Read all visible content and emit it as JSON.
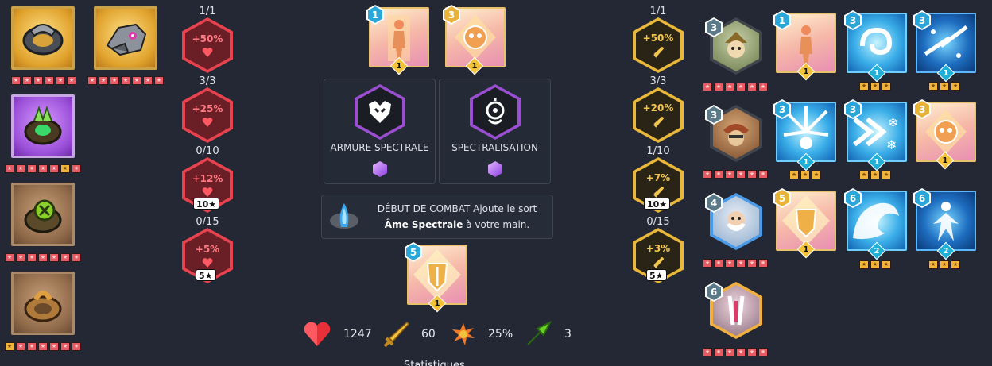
{
  "equipment": [
    {
      "name": "anneau-gris",
      "stars": "6"
    },
    {
      "name": "familier-gris",
      "stars": "7"
    },
    {
      "name": "anneau-violet",
      "stars": "7"
    },
    {
      "name": "anneau-vert",
      "stars": "7"
    },
    {
      "name": "anneau-bronze",
      "stars": "7"
    }
  ],
  "stats_left": [
    {
      "fraction": "1/1",
      "value": "+50%",
      "req": ""
    },
    {
      "fraction": "3/3",
      "value": "+25%",
      "req": ""
    },
    {
      "fraction": "0/10",
      "value": "+12%",
      "req": "10★"
    },
    {
      "fraction": "0/15",
      "value": "+5%",
      "req": "5★"
    }
  ],
  "stats_right": [
    {
      "fraction": "1/1",
      "value": "+50%",
      "req": ""
    },
    {
      "fraction": "3/3",
      "value": "+20%",
      "req": ""
    },
    {
      "fraction": "1/10",
      "value": "+7%",
      "req": "10★"
    },
    {
      "fraction": "0/15",
      "value": "+3%",
      "req": "5★"
    }
  ],
  "center": {
    "top_cards": [
      {
        "cost": "1",
        "level": "1"
      },
      {
        "cost": "3",
        "level": "1"
      }
    ],
    "passives": [
      {
        "name": "ARMURE SPECTRALE"
      },
      {
        "name": "SPECTRALISATION"
      }
    ],
    "effect": {
      "part1": "DÉBUT DE COMBAT Ajoute le sort",
      "bold": "Âme Spectrale",
      "part2": " à votre main."
    },
    "bottom_card": {
      "cost": "5",
      "level": "1"
    }
  },
  "totals": {
    "health": "1247",
    "attack": "60",
    "crit": "25%",
    "move": "3"
  },
  "footer_partial": "Statistiques",
  "companions": [
    {
      "cost": "3"
    },
    {
      "cost": "3"
    },
    {
      "cost": "4"
    },
    {
      "cost": "6"
    }
  ],
  "spells": [
    {
      "cost": "1",
      "level": "1",
      "stars": "",
      "style": "pink"
    },
    {
      "cost": "3",
      "level": "1",
      "stars": "★★★",
      "style": "blue"
    },
    {
      "cost": "3",
      "level": "1",
      "stars": "★★★",
      "style": "deep"
    },
    {
      "cost": "3",
      "level": "1",
      "stars": "★★★",
      "style": "blue"
    },
    {
      "cost": "3",
      "level": "1",
      "stars": "★★★",
      "style": "blue"
    },
    {
      "cost": "3",
      "level": "1",
      "stars": "",
      "style": "pink"
    },
    {
      "cost": "5",
      "level": "1",
      "stars": "",
      "style": "pink"
    },
    {
      "cost": "6",
      "level": "2",
      "stars": "★★★",
      "style": "blue"
    },
    {
      "cost": "6",
      "level": "2",
      "stars": "★★★",
      "style": "deep"
    }
  ],
  "colors": {
    "background": "#232834",
    "health_red": "#e8424e",
    "attack_gold": "#e9b73a",
    "star_pink": "#e85a63"
  }
}
